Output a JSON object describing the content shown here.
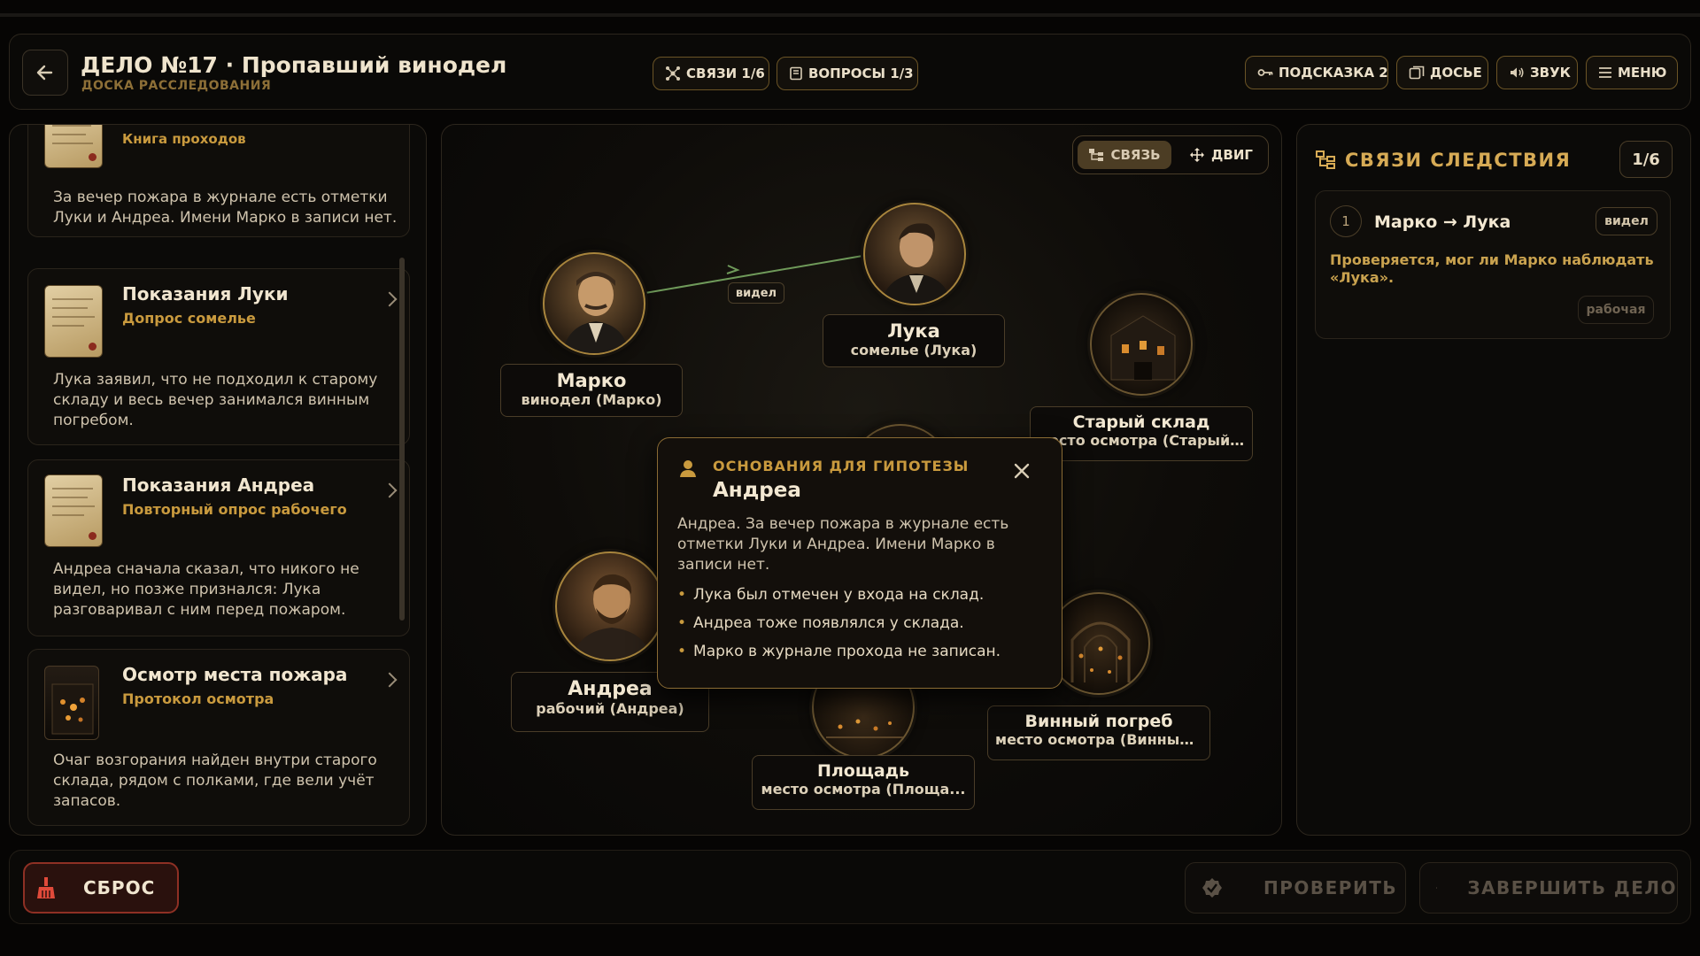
{
  "header": {
    "title": "ДЕЛО №17 · Пропавший винодел",
    "subtitle": "ДОСКА РАССЛЕДОВАНИЯ",
    "links_chip": "СВЯЗИ 1/6",
    "questions_chip": "ВОПРОСЫ 1/3",
    "hint_button": "ПОДСКАЗКА 2",
    "dossier_button": "ДОСЬЕ",
    "sound_button": "ЗВУК",
    "menu_button": "МЕНЮ"
  },
  "evidence": [
    {
      "title": "",
      "subtitle": "Книга проходов",
      "text": "За вечер пожара в журнале есть отметки Луки и Андреа. Имени Марко в записи нет."
    },
    {
      "title": "Показания Луки",
      "subtitle": "Допрос сомелье",
      "text": "Лука заявил, что не подходил к старому складу и весь вечер занимался винным погребом."
    },
    {
      "title": "Показания Андреа",
      "subtitle": "Повторный опрос рабочего",
      "text": "Андреа сначала сказал, что никого не видел, но позже признался: Лука разговаривал с ним перед пожаром."
    },
    {
      "title": "Осмотр места пожара",
      "subtitle": "Протокол осмотра",
      "text": "Очаг возгорания найден внутри старого склада, рядом с полками, где вели учёт запасов."
    }
  ],
  "board": {
    "mode_link": "СВЯЗЬ",
    "mode_move": "ДВИГ",
    "edge_label": "видел",
    "nodes": [
      {
        "name": "Марко",
        "role": "винодел (Марко)"
      },
      {
        "name": "Лука",
        "role": "сомелье (Лука)"
      },
      {
        "name": "Старый склад",
        "role": "место осмотра (Старый ..."
      },
      {
        "name": "Андреа",
        "role": "рабочий (Андреа)"
      },
      {
        "name": "Винный погреб",
        "role": "место осмотра (Винный..."
      },
      {
        "name": "Площадь",
        "role": "место осмотра (Площа..."
      }
    ]
  },
  "popover": {
    "heading": "ОСНОВАНИЯ ДЛЯ ГИПОТЕЗЫ",
    "name": "Андреа",
    "text": "Андреа. За вечер пожара в журнале есть отметки Луки и Андреа. Имени Марко в записи нет.",
    "bullets": [
      "Лука был отмечен у входа на склад.",
      "Андреа тоже появлялся у склада.",
      "Марко в журнале прохода не записан."
    ]
  },
  "connections": {
    "title": "СВЯЗИ СЛЕДСТВИЯ",
    "count": "1/6",
    "items": [
      {
        "num": "1",
        "title": "Марко → Лука",
        "tag": "видел",
        "text": "Проверяется, мог ли Марко наблюдать «Лука».",
        "status": "рабочая"
      }
    ]
  },
  "footer": {
    "reset": "СБРОС",
    "check": "ПРОВЕРИТЬ",
    "finish": "ЗАВЕРШИТЬ ДЕЛО"
  },
  "colors": {
    "accent_gold": "#c99a3e",
    "reset_red": "#8e3024",
    "link_green": "#6f9a5a"
  }
}
